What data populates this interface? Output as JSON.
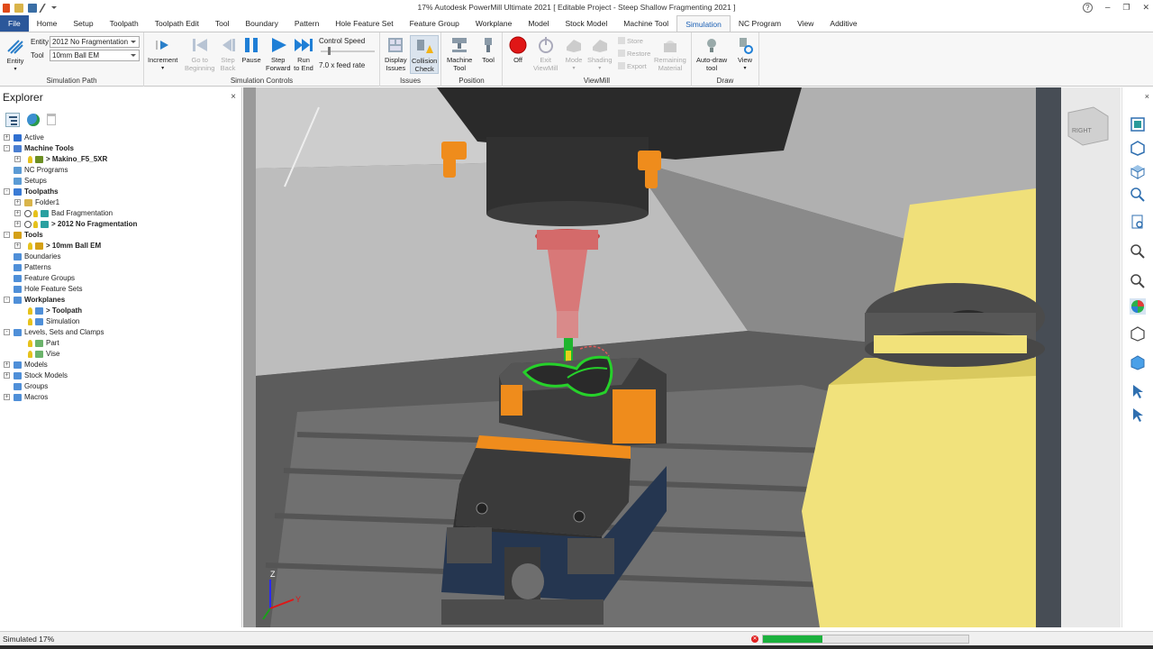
{
  "window": {
    "title": "17% Autodesk PowerMill Ultimate 2021   [ Editable Project - Steep Shallow Fragmenting 2021 ]",
    "help_glyph": "?",
    "min_glyph": "–",
    "restore_glyph": "❐",
    "close_glyph": "✕"
  },
  "tabs": [
    "File",
    "Home",
    "Setup",
    "Toolpath",
    "Toolpath Edit",
    "Tool",
    "Boundary",
    "Pattern",
    "Hole Feature Set",
    "Feature Group",
    "Workplane",
    "Model",
    "Stock Model",
    "Machine Tool",
    "Simulation",
    "NC Program",
    "View",
    "Additive"
  ],
  "active_tab": "Simulation",
  "ribbon": {
    "sim_path": {
      "entity_label": "Entity",
      "tool_label": "Tool",
      "entity_value": "2012 No Fragmentation",
      "tool_value": "10mm Ball EM",
      "entity_button": "Entity",
      "group_label": "Simulation Path"
    },
    "controls": {
      "increment": "Increment",
      "go_to_beginning": [
        "Go to",
        "Beginning"
      ],
      "step_back": [
        "Step",
        "Back"
      ],
      "pause": "Pause",
      "step_forward": [
        "Step",
        "Forward"
      ],
      "run_to_end": [
        "Run",
        "to End"
      ],
      "control_speed": "Control Speed",
      "feed_rate": "7.0 x feed rate",
      "group_label": "Simulation Controls"
    },
    "issues": {
      "display_issues": [
        "Display",
        "Issues"
      ],
      "collision_check": [
        "Collision",
        "Check"
      ],
      "group_label": "Issues"
    },
    "position": {
      "machine_tool": [
        "Machine",
        "Tool"
      ],
      "tool": "Tool",
      "group_label": "Position"
    },
    "viewmill": {
      "off": "Off",
      "exit_viewmill": [
        "Exit",
        "ViewMill"
      ],
      "mode": "Mode",
      "shading": "Shading",
      "store": "Store",
      "restore": "Restore",
      "export": "Export",
      "remaining_material": [
        "Remaining",
        "Material"
      ],
      "group_label": "ViewMill"
    },
    "draw": {
      "auto_draw_tool": [
        "Auto-draw",
        "tool"
      ],
      "view": "View",
      "group_label": "Draw"
    }
  },
  "explorer": {
    "title": "Explorer",
    "close": "×",
    "tree": [
      {
        "label": "Active",
        "level": 0,
        "expander": "+",
        "icon": "active-icon",
        "color": "#2f6fd0",
        "bold": false
      },
      {
        "label": "Machine Tools",
        "level": 0,
        "expander": "-",
        "icon": "machine-tools-icon",
        "color": "#4a7ed1",
        "bold": true
      },
      {
        "label": "> Makino_F5_5XR",
        "level": 1,
        "expander": "+",
        "icon": "machine-icon",
        "color": "#6b8e23",
        "bold": true
      },
      {
        "label": "NC Programs",
        "level": 0,
        "expander": "",
        "icon": "nc-programs-icon",
        "color": "#5b9bd5",
        "bold": false
      },
      {
        "label": "Setups",
        "level": 0,
        "expander": "",
        "icon": "setups-icon",
        "color": "#5b9bd5",
        "bold": false
      },
      {
        "label": "Toolpaths",
        "level": 0,
        "expander": "-",
        "icon": "toolpaths-icon",
        "color": "#3a7bd5",
        "bold": true
      },
      {
        "label": "Folder1",
        "level": 1,
        "expander": "+",
        "icon": "folder-icon",
        "color": "#d9b44a",
        "bold": false
      },
      {
        "label": "Bad Fragmentation",
        "level": 1,
        "expander": "+",
        "icon": "toolpath-icon",
        "color": "#2aa0a0",
        "bold": false
      },
      {
        "label": "> 2012 No Fragmentation",
        "level": 1,
        "expander": "+",
        "icon": "toolpath-icon",
        "color": "#2aa0a0",
        "bold": true
      },
      {
        "label": "Tools",
        "level": 0,
        "expander": "-",
        "icon": "tools-icon",
        "color": "#d4a017",
        "bold": true
      },
      {
        "label": "> 10mm Ball EM",
        "level": 1,
        "expander": "+",
        "icon": "tool-icon",
        "color": "#d4a017",
        "bold": true
      },
      {
        "label": "Boundaries",
        "level": 0,
        "expander": "",
        "icon": "boundaries-icon",
        "color": "#4f8fd8",
        "bold": false
      },
      {
        "label": "Patterns",
        "level": 0,
        "expander": "",
        "icon": "patterns-icon",
        "color": "#4f8fd8",
        "bold": false
      },
      {
        "label": "Feature Groups",
        "level": 0,
        "expander": "",
        "icon": "feature-groups-icon",
        "color": "#4f8fd8",
        "bold": false
      },
      {
        "label": "Hole Feature Sets",
        "level": 0,
        "expander": "",
        "icon": "hole-feature-sets-icon",
        "color": "#4f8fd8",
        "bold": false
      },
      {
        "label": "Workplanes",
        "level": 0,
        "expander": "-",
        "icon": "workplanes-icon",
        "color": "#4f8fd8",
        "bold": true
      },
      {
        "label": "> Toolpath",
        "level": 1,
        "expander": "",
        "icon": "workplane-icon",
        "color": "#4f8fd8",
        "bold": true
      },
      {
        "label": "Simulation",
        "level": 1,
        "expander": "",
        "icon": "workplane-icon",
        "color": "#4f8fd8",
        "bold": false
      },
      {
        "label": "Levels, Sets and Clamps",
        "level": 0,
        "expander": "-",
        "icon": "levels-icon",
        "color": "#4f8fd8",
        "bold": false
      },
      {
        "label": "Part",
        "level": 1,
        "expander": "",
        "icon": "level-icon",
        "color": "#6bb36b",
        "bold": false
      },
      {
        "label": "Vise",
        "level": 1,
        "expander": "",
        "icon": "level-icon",
        "color": "#6bb36b",
        "bold": false
      },
      {
        "label": "Models",
        "level": 0,
        "expander": "+",
        "icon": "models-icon",
        "color": "#4f8fd8",
        "bold": false
      },
      {
        "label": "Stock Models",
        "level": 0,
        "expander": "+",
        "icon": "stock-models-icon",
        "color": "#4f8fd8",
        "bold": false
      },
      {
        "label": "Groups",
        "level": 0,
        "expander": "",
        "icon": "groups-icon",
        "color": "#4f8fd8",
        "bold": false
      },
      {
        "label": "Macros",
        "level": 0,
        "expander": "+",
        "icon": "macros-icon",
        "color": "#4f8fd8",
        "bold": false
      }
    ]
  },
  "viewport": {
    "viewcube_label": "RIGHT",
    "axis_z": "Z",
    "axis_y": "Y"
  },
  "status": {
    "text": "Simulated 17%",
    "progress_fraction": 0.29
  }
}
